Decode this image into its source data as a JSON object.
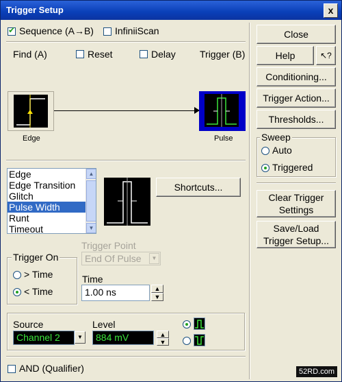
{
  "window": {
    "title": "Trigger Setup",
    "close_glyph": "x"
  },
  "top_options": {
    "sequence": {
      "label": "Sequence (A→B)",
      "checked": true
    },
    "infiniiscan": {
      "label": "InfiniiScan",
      "checked": false
    }
  },
  "sequence_row": {
    "find_label": "Find (A)",
    "reset": {
      "label": "Reset",
      "checked": false
    },
    "delay": {
      "label": "Delay",
      "checked": false
    },
    "trigger_label": "Trigger (B)"
  },
  "diagram": {
    "a_label": "Edge",
    "b_label": "Pulse"
  },
  "trigger_types": {
    "items": [
      "Edge",
      "Edge Transition",
      "Glitch",
      "Pulse Width",
      "Runt",
      "Timeout"
    ],
    "selected": "Pulse Width"
  },
  "shortcuts_label": "Shortcuts...",
  "trigger_on": {
    "title": "Trigger On",
    "options": [
      "> Time",
      "< Time"
    ],
    "selected": "< Time"
  },
  "trigger_point": {
    "label": "Trigger Point",
    "value": "End Of Pulse"
  },
  "time": {
    "label": "Time",
    "value": "1.00 ns"
  },
  "source": {
    "label": "Source",
    "value": "Channel 2"
  },
  "level": {
    "label": "Level",
    "value": "884 mV"
  },
  "polarity": {
    "selected": "positive"
  },
  "and_qualifier": {
    "label": "AND (Qualifier)",
    "checked": false
  },
  "right_panel": {
    "close": "Close",
    "help": "Help",
    "help_pointer": "↖?",
    "conditioning": "Conditioning...",
    "trigger_action": "Trigger Action...",
    "thresholds": "Thresholds...",
    "sweep": {
      "title": "Sweep",
      "options": [
        "Auto",
        "Triggered"
      ],
      "selected": "Triggered"
    },
    "clear_trigger": "Clear Trigger Settings",
    "save_load": "Save/Load Trigger Setup..."
  },
  "watermark": "52RD.com",
  "colors": {
    "title_bar": "#0a3fb8",
    "selected_b": "#0000c8",
    "trace_green": "#3ce63c",
    "list_selection": "#316ac5"
  }
}
